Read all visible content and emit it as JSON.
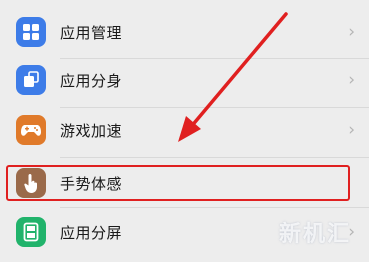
{
  "settings_list": {
    "items": [
      {
        "label": "应用管理",
        "icon": "app-management-icon",
        "icon_color": "#3d7ce8"
      },
      {
        "label": "应用分身",
        "icon": "app-clone-icon",
        "icon_color": "#3d7ce8"
      },
      {
        "label": "游戏加速",
        "icon": "gamepad-icon",
        "icon_color": "#e07a2a"
      },
      {
        "label": "手势体感",
        "icon": "hand-gesture-icon",
        "icon_color": "#9a6a4a"
      },
      {
        "label": "应用分屏",
        "icon": "split-screen-icon",
        "icon_color": "#21b36b"
      }
    ],
    "chevron": "›"
  },
  "annotation": {
    "highlight_color": "#e02020",
    "arrow_color": "#e02020"
  },
  "watermark": {
    "text": "新机汇"
  }
}
